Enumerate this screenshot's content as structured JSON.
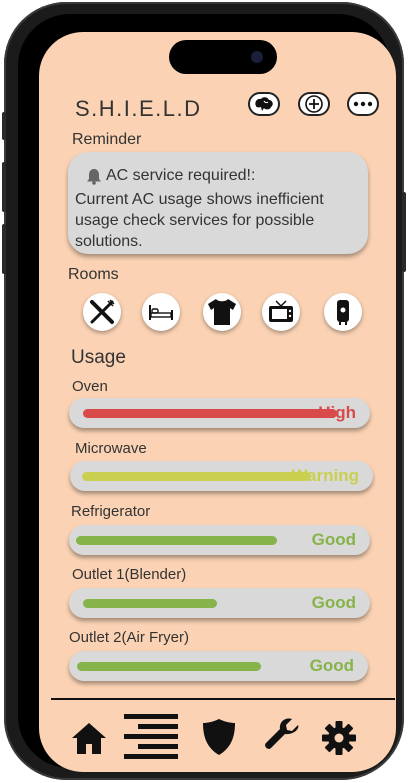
{
  "app": {
    "title": "S.H.I.E.L.D"
  },
  "colors": {
    "background": "#fbd3b4",
    "card": "#d9d9d9",
    "high": "#d94b4b",
    "warning": "#c9d04f",
    "good": "#86b34a"
  },
  "header": {
    "buttons": [
      {
        "icon": "brain-icon"
      },
      {
        "icon": "plus-icon"
      },
      {
        "icon": "more-icon"
      }
    ]
  },
  "reminder": {
    "label": "Reminder",
    "icon": "bell-icon",
    "heading": "AC service required!:",
    "message": "Current AC usage shows inefficient usage check services for possible solutions."
  },
  "rooms": {
    "label": "Rooms",
    "items": [
      {
        "icon": "fork-knife-icon"
      },
      {
        "icon": "bed-icon"
      },
      {
        "icon": "shirt-icon"
      },
      {
        "icon": "tv-icon"
      },
      {
        "icon": "water-heater-icon"
      }
    ]
  },
  "usage": {
    "title": "Usage",
    "items": [
      {
        "label": "Oven",
        "status": "High",
        "level": 0.93,
        "color": "#d94b4b"
      },
      {
        "label": "Microwave",
        "status": "Warning",
        "level": 0.82,
        "color": "#c9d04f"
      },
      {
        "label": "Refrigerator",
        "status": "Good",
        "level": 0.7,
        "color": "#86b34a"
      },
      {
        "label": "Outlet 1(Blender)",
        "status": "Good",
        "level": 0.49,
        "color": "#86b34a"
      },
      {
        "label": "Outlet 2(Air Fryer)",
        "status": "Good",
        "level": 0.65,
        "color": "#86b34a"
      }
    ]
  },
  "nav": {
    "items": [
      {
        "icon": "home-icon"
      },
      {
        "icon": "menu-icon"
      },
      {
        "icon": "shield-icon"
      },
      {
        "icon": "wrench-icon"
      },
      {
        "icon": "gear-icon"
      }
    ]
  }
}
